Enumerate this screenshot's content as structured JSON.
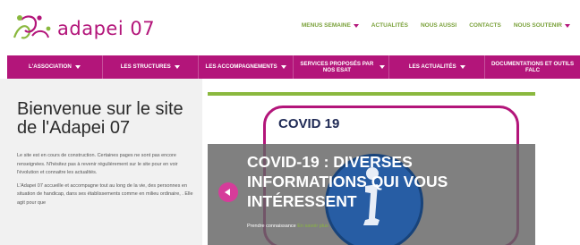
{
  "brand": {
    "name": "adapei 07"
  },
  "top_nav": [
    {
      "label": "Menus semaine",
      "caret": true
    },
    {
      "label": "Actualités",
      "caret": false
    },
    {
      "label": "Nous aussi",
      "caret": false
    },
    {
      "label": "Contacts",
      "caret": false
    },
    {
      "label": "Nous soutenir",
      "caret": true
    }
  ],
  "main_nav": [
    {
      "label": "L'Association",
      "caret": true
    },
    {
      "label": "Les structures",
      "caret": true
    },
    {
      "label": "Les accompagnements",
      "caret": true
    },
    {
      "label": "Services proposés par nos ESAT",
      "caret": true
    },
    {
      "label": "Les actualités",
      "caret": true
    },
    {
      "label": "Documentations et outils FALC",
      "caret": false
    }
  ],
  "welcome": {
    "title": "Bienvenue sur le site de l'Adapei 07",
    "para1": "Le site est en cours de construction. Certaines pages ne sont pas encore renseignées. N'hésitez pas à revenir régulièrement sur le site pour en voir l'évolution et connaitre les actualités.",
    "para2": "L'Adapei 07 accueille et accompagne tout au long de la vie, des personnes en situation de handicap, dans ses établissements comme en milieu ordinaire, . Elle agit pour que"
  },
  "slider": {
    "card_title": "COVID 19",
    "headline": "COVID-19 : DIVERSES INFORMATIONS QUI VOUS INTÉRESSENT",
    "more_text": "Prendre connaissance",
    "more_link": "En savoir plus"
  },
  "colors": {
    "brand_magenta": "#b3157a",
    "accent_green": "#8ab83e",
    "navy": "#1f2a55"
  },
  "icons": [
    "logo-mark-icon",
    "chevron-down-icon",
    "info-icon",
    "prev-arrow-icon"
  ]
}
